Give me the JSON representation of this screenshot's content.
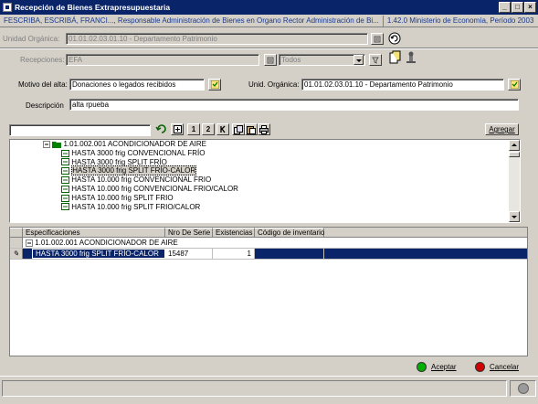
{
  "window": {
    "title": "Recepción de Bienes Extrapresupuestaria",
    "min": "_",
    "max": "□",
    "close": "×"
  },
  "infobar": {
    "org": "FESCRIBA, ESCRIBÁ, FRANCI..., Responsable Administración de Bienes en Organo Rector Administración de Bi...",
    "version": "1.42.0 Ministerio de Economía, Período 2003"
  },
  "form": {
    "unidad_label": "Unidad Orgánica:",
    "unidad_value": "01.01.02.03.01.10 - Departamento Patrimonio",
    "recepciones_label": "Recepciones:",
    "recepciones_value": "EFA",
    "todos_value": "Todos",
    "motivo_label": "Motivo del alta:",
    "motivo_value": "Donaciones o legados recibidos",
    "unid2_label": "Unid. Orgánica:",
    "unid2_value": "01.01.02.03.01.10 - Departamento Patrimonio",
    "descripcion_label": "Descripción",
    "descripcion_value": "alta rpueba"
  },
  "toolbar": {
    "b1": "1",
    "b2": "2",
    "agregar": "Agregar"
  },
  "tree": {
    "root": "1.01.002.001 ACONDICIONADOR DE AIRE",
    "items": [
      "HASTA 3000 frig CONVENCIONAL FRÍO",
      "HASTA 3000 frig SPLIT FRÍO",
      "HASTA 3000 frig SPLIT FRÍO-CALOR",
      "HASTA 10.000 frig CONVENCIONAL FRIO",
      "HASTA 10.000 frig CONVENCIONAL FRIO/CALOR",
      "HASTA 10.000 frig SPLIT FRIO",
      "HASTA 10.000 frig SPLIT FRIO/CALOR"
    ]
  },
  "grid": {
    "headers": [
      "Especificaciones",
      "Nro De Serie",
      "Existencias",
      "Código de inventario"
    ],
    "group": "1.01.002.001 ACONDICIONADOR DE AIRE",
    "row": {
      "spec": "HASTA 3000 frig SPLIT FRÍO-CALOR",
      "serie": "15487",
      "exist": "1",
      "codigo": ""
    }
  },
  "buttons": {
    "aceptar": "Aceptar",
    "cancelar": "Cancelar"
  }
}
